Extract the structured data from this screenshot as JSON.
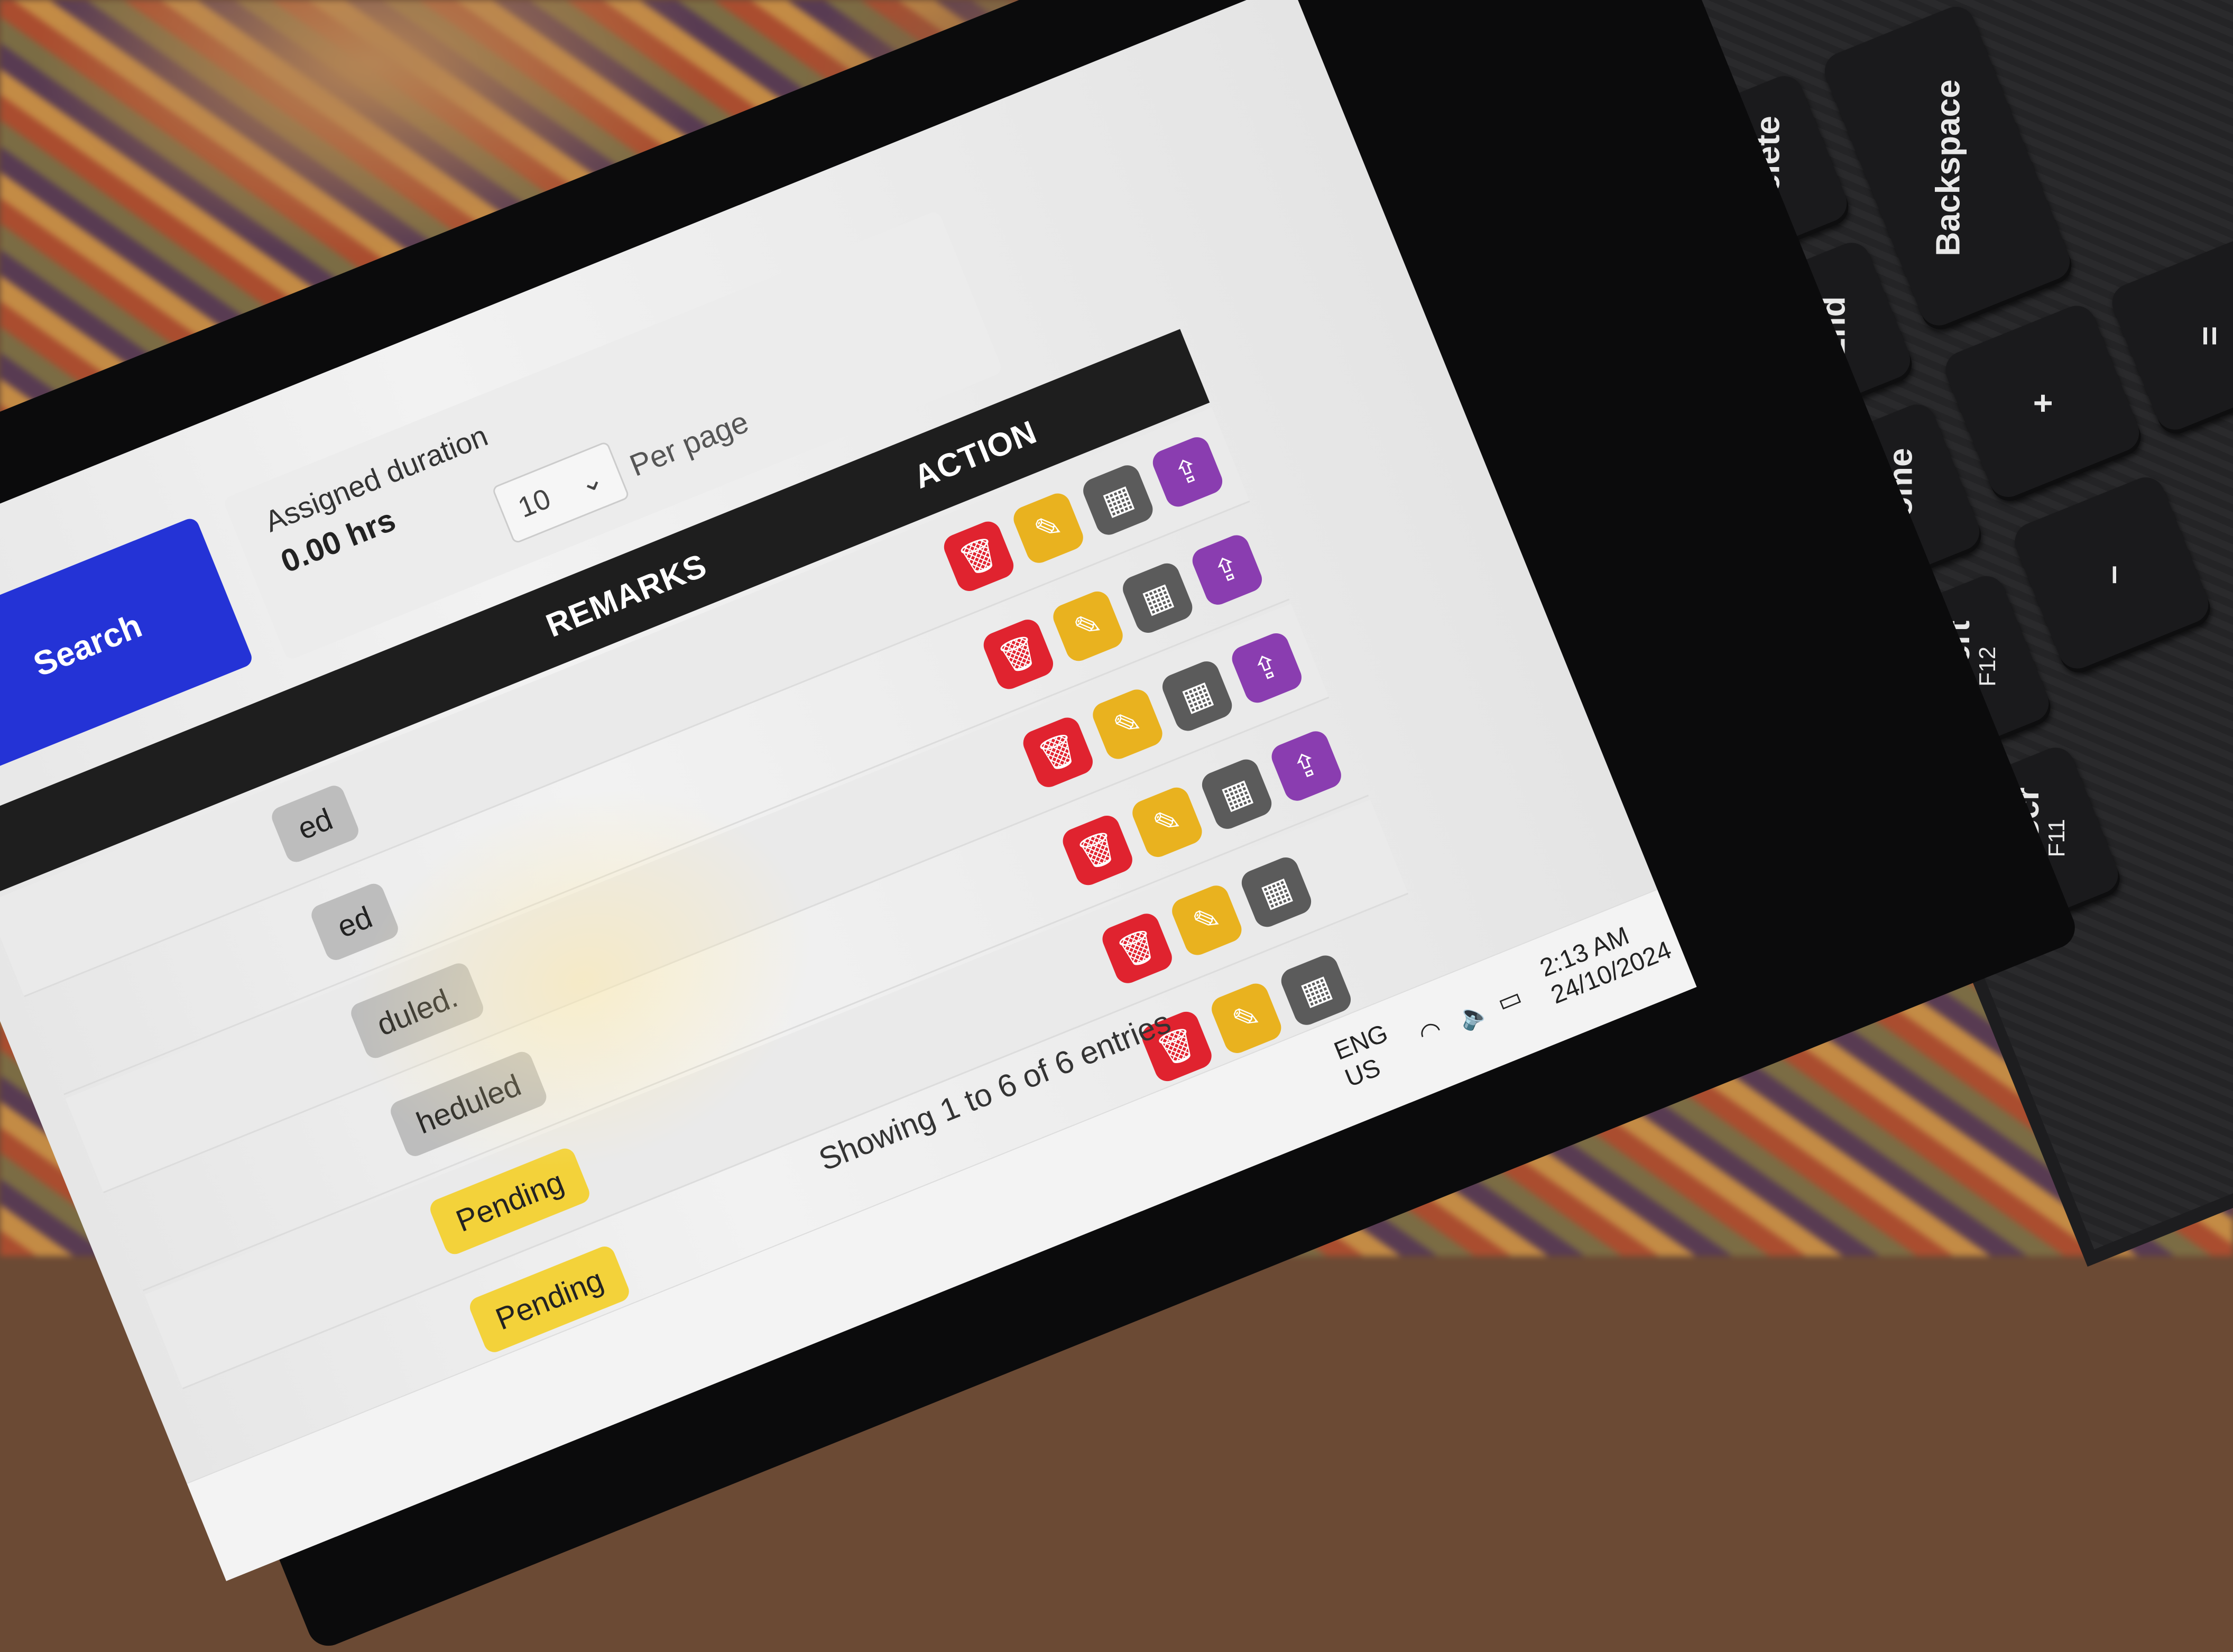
{
  "search": {
    "button_label": "Search"
  },
  "filters": {
    "assigned_duration_label": "Assigned duration",
    "assigned_duration_value": "0.00 hrs",
    "per_page_value": "10",
    "per_page_label": "Per page"
  },
  "table": {
    "headers": {
      "remarks": "REMARKS",
      "action": "ACTION"
    },
    "rows": [
      {
        "status": "ed",
        "status_type": "scheduled",
        "actions": [
          "delete",
          "edit",
          "calendar",
          "upload"
        ]
      },
      {
        "status": "ed",
        "status_type": "scheduled",
        "actions": [
          "delete",
          "edit",
          "calendar",
          "upload"
        ]
      },
      {
        "status": "duled.",
        "status_type": "scheduled",
        "actions": [
          "delete",
          "edit",
          "calendar",
          "upload"
        ]
      },
      {
        "status": "heduled",
        "status_type": "scheduled",
        "actions": [
          "delete",
          "edit",
          "calendar",
          "upload"
        ]
      },
      {
        "status": "Pending",
        "status_type": "pending",
        "actions": [
          "delete",
          "edit",
          "calendar"
        ]
      },
      {
        "status": "Pending",
        "status_type": "pending",
        "actions": [
          "delete",
          "edit",
          "calendar"
        ]
      }
    ],
    "entries_info": "Showing 1 to 6 of 6 entries"
  },
  "taskbar": {
    "time": "2:13 AM",
    "date": "24/10/2024",
    "lang_top": "ENG",
    "lang_bottom": "US"
  },
  "keyboard": {
    "keys": [
      {
        "label": "Delete"
      },
      {
        "label": "Backspace"
      },
      {
        "label": "End"
      },
      {
        "label": "Home"
      },
      {
        "label": "Insert",
        "sub": "F12"
      },
      {
        "label": "PrtScr",
        "sub": "F11"
      },
      {
        "label": "+"
      },
      {
        "label": "="
      },
      {
        "label": "–"
      }
    ]
  },
  "colors": {
    "search_button": "#2433d6",
    "delete": "#e0232f",
    "edit": "#e9b21f",
    "calendar": "#5b5b5b",
    "upload": "#8a3db0",
    "pending": "#f3d23a",
    "header": "#1e1e1e"
  }
}
